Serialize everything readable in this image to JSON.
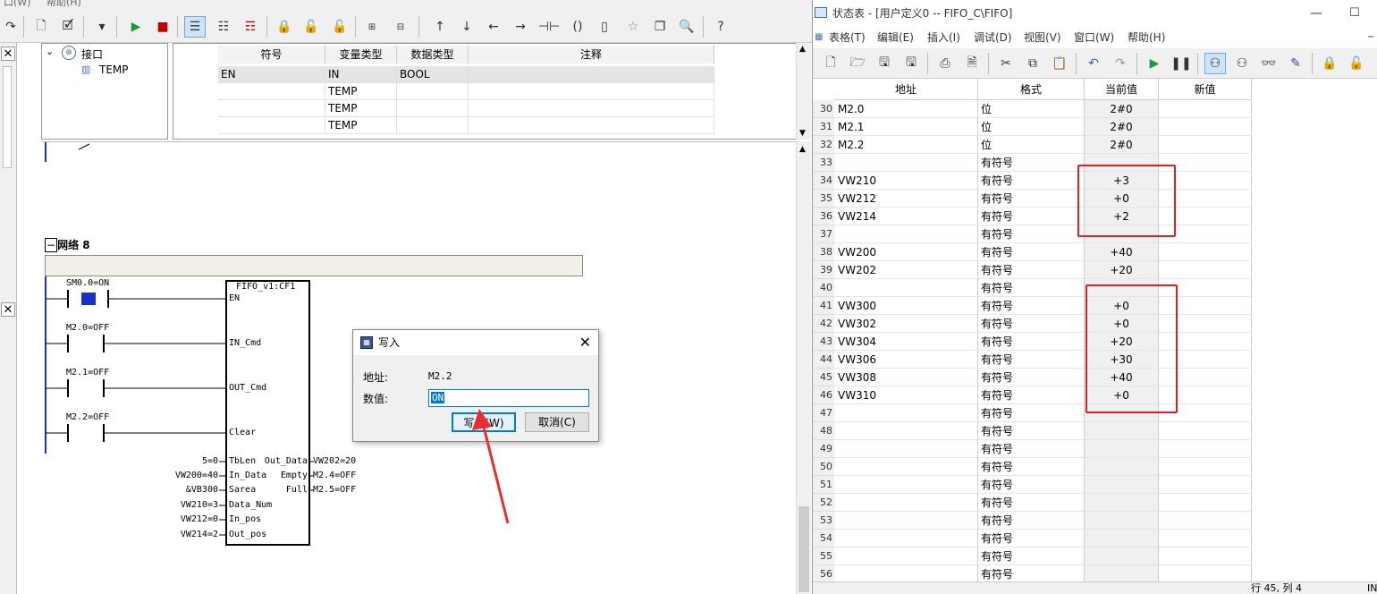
{
  "left_window": {
    "menu": [
      "口(W)",
      "帮助(H)"
    ],
    "interface": {
      "tree_root": "接口",
      "tree_child": "TEMP",
      "headers": [
        "符号",
        "变量类型",
        "数据类型",
        "注释"
      ],
      "rows": [
        {
          "symbol": "EN",
          "var_type": "IN",
          "data_type": "BOOL"
        },
        {
          "symbol": "",
          "var_type": "TEMP",
          "data_type": ""
        },
        {
          "symbol": "",
          "var_type": "TEMP",
          "data_type": ""
        },
        {
          "symbol": "",
          "var_type": "TEMP",
          "data_type": ""
        }
      ]
    },
    "ladder": {
      "network_label": "网络 8",
      "fb_name": "FIFO_v1:CF1",
      "contacts": [
        "SM0.0=ON",
        "M2.0=OFF",
        "M2.1=OFF",
        "M2.2=OFF"
      ],
      "pins_left_logic": [
        "EN",
        "IN_Cmd",
        "OUT_Cmd",
        "Clear"
      ],
      "pins_left_params": [
        "TbLen",
        "In_Data",
        "Sarea",
        "Data_Num",
        "In_pos",
        "Out_pos"
      ],
      "inputs": [
        "5=0",
        "VW200=40",
        "&VB300",
        "VW210=3",
        "VW212=0",
        "VW214=2"
      ],
      "pins_right": [
        "Out_Data",
        "Empty",
        "Full"
      ],
      "outputs": [
        "VW202=20",
        "M2.4=OFF",
        "M2.5=OFF"
      ]
    }
  },
  "dialog": {
    "title": "写入",
    "address_label": "地址:",
    "address_value": "M2.2",
    "value_label": "数值:",
    "value_input": "ON",
    "write_button": "写入(W)",
    "cancel_button": "取消(C)"
  },
  "right_window": {
    "title": "状态表 - [用户定义0 -- FIFO_C\\FIFO]",
    "menu": [
      "表格(T)",
      "编辑(E)",
      "插入(I)",
      "调试(D)",
      "视图(V)",
      "窗口(W)",
      "帮助(H)"
    ],
    "headers": [
      "地址",
      "格式",
      "当前值",
      "新值"
    ],
    "rows": [
      {
        "n": "30",
        "addr": "M2.0",
        "fmt": "位",
        "val": "2#0"
      },
      {
        "n": "31",
        "addr": "M2.1",
        "fmt": "位",
        "val": "2#0"
      },
      {
        "n": "32",
        "addr": "M2.2",
        "fmt": "位",
        "val": "2#0"
      },
      {
        "n": "33",
        "addr": "",
        "fmt": "有符号",
        "val": ""
      },
      {
        "n": "34",
        "addr": "VW210",
        "fmt": "有符号",
        "val": "+3"
      },
      {
        "n": "35",
        "addr": "VW212",
        "fmt": "有符号",
        "val": "+0"
      },
      {
        "n": "36",
        "addr": "VW214",
        "fmt": "有符号",
        "val": "+2"
      },
      {
        "n": "37",
        "addr": "",
        "fmt": "有符号",
        "val": ""
      },
      {
        "n": "38",
        "addr": "VW200",
        "fmt": "有符号",
        "val": "+40"
      },
      {
        "n": "39",
        "addr": "VW202",
        "fmt": "有符号",
        "val": "+20"
      },
      {
        "n": "40",
        "addr": "",
        "fmt": "有符号",
        "val": ""
      },
      {
        "n": "41",
        "addr": "VW300",
        "fmt": "有符号",
        "val": "+0"
      },
      {
        "n": "42",
        "addr": "VW302",
        "fmt": "有符号",
        "val": "+0"
      },
      {
        "n": "43",
        "addr": "VW304",
        "fmt": "有符号",
        "val": "+20"
      },
      {
        "n": "44",
        "addr": "VW306",
        "fmt": "有符号",
        "val": "+30"
      },
      {
        "n": "45",
        "addr": "VW308",
        "fmt": "有符号",
        "val": "+40"
      },
      {
        "n": "46",
        "addr": "VW310",
        "fmt": "有符号",
        "val": "+0"
      },
      {
        "n": "47",
        "addr": "",
        "fmt": "有符号",
        "val": ""
      },
      {
        "n": "48",
        "addr": "",
        "fmt": "有符号",
        "val": ""
      },
      {
        "n": "49",
        "addr": "",
        "fmt": "有符号",
        "val": ""
      },
      {
        "n": "50",
        "addr": "",
        "fmt": "有符号",
        "val": ""
      },
      {
        "n": "51",
        "addr": "",
        "fmt": "有符号",
        "val": ""
      },
      {
        "n": "52",
        "addr": "",
        "fmt": "有符号",
        "val": ""
      },
      {
        "n": "53",
        "addr": "",
        "fmt": "有符号",
        "val": ""
      },
      {
        "n": "54",
        "addr": "",
        "fmt": "有符号",
        "val": ""
      },
      {
        "n": "55",
        "addr": "",
        "fmt": "有符号",
        "val": ""
      },
      {
        "n": "56",
        "addr": "",
        "fmt": "有符号",
        "val": ""
      }
    ],
    "status": "行 45, 列 4",
    "status_mode": "IN"
  },
  "colors": {
    "highlight_red": "#e02020",
    "arrow_red": "#e53030",
    "toolbar_active": "#cce4f7"
  }
}
